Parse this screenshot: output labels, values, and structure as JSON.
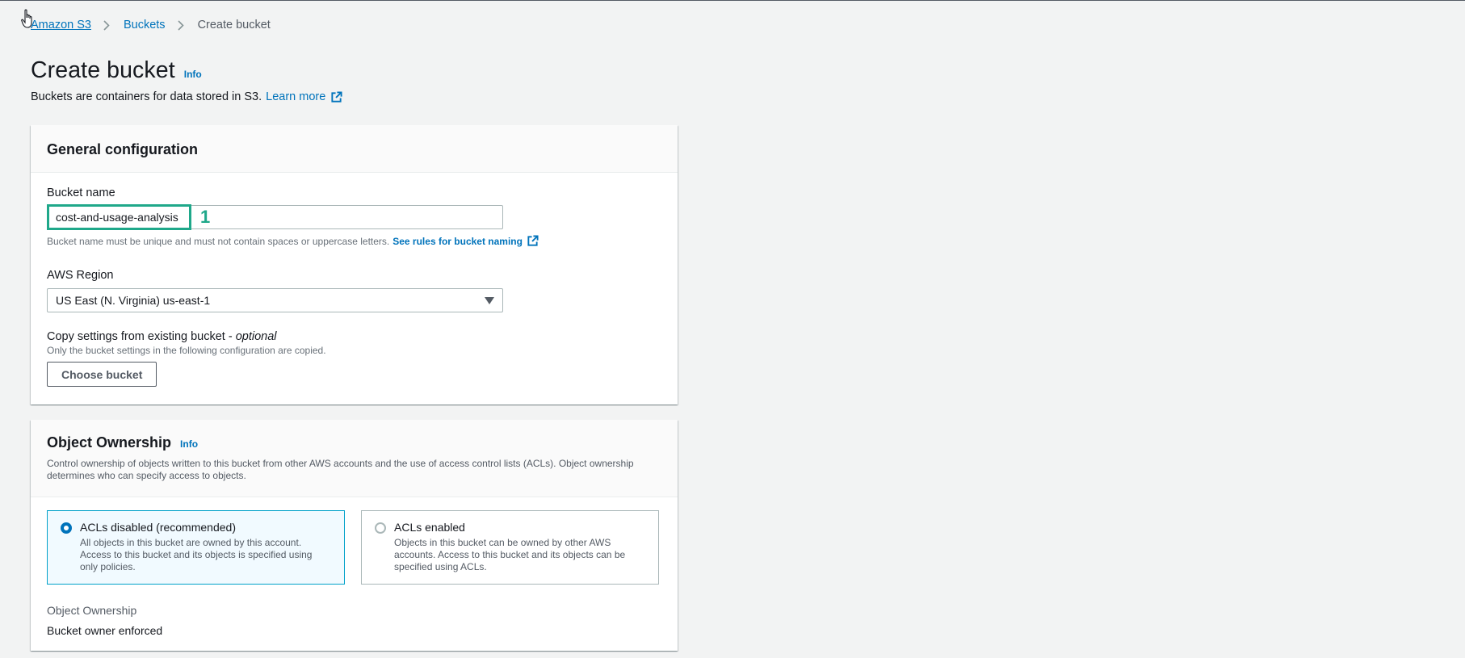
{
  "breadcrumb": {
    "items": [
      "Amazon S3",
      "Buckets"
    ],
    "current": "Create bucket"
  },
  "page": {
    "title": "Create bucket",
    "info": "Info",
    "description": "Buckets are containers for data stored in S3.",
    "learn_more": "Learn more"
  },
  "general": {
    "heading": "General configuration",
    "bucket_name_label": "Bucket name",
    "bucket_name_value": "cost-and-usage-analysis",
    "annotation_number": "1",
    "bucket_name_hint": "Bucket name must be unique and must not contain spaces or uppercase letters.",
    "rules_link": "See rules for bucket naming",
    "region_label": "AWS Region",
    "region_value": "US East (N. Virginia) us-east-1",
    "copy_label": "Copy settings from existing bucket - ",
    "copy_optional": "optional",
    "copy_hint": "Only the bucket settings in the following configuration are copied.",
    "choose_bucket": "Choose bucket"
  },
  "ownership": {
    "heading": "Object Ownership",
    "info": "Info",
    "description": "Control ownership of objects written to this bucket from other AWS accounts and the use of access control lists (ACLs). Object ownership determines who can specify access to objects.",
    "options": [
      {
        "title": "ACLs disabled (recommended)",
        "desc": "All objects in this bucket are owned by this account. Access to this bucket and its objects is specified using only policies.",
        "selected": true
      },
      {
        "title": "ACLs enabled",
        "desc": "Objects in this bucket can be owned by other AWS accounts. Access to this bucket and its objects can be specified using ACLs.",
        "selected": false
      }
    ],
    "readout_label": "Object Ownership",
    "readout_value": "Bucket owner enforced"
  },
  "colors": {
    "link": "#0073bb",
    "annotation": "#1fa88a",
    "background": "#f2f3f3"
  }
}
